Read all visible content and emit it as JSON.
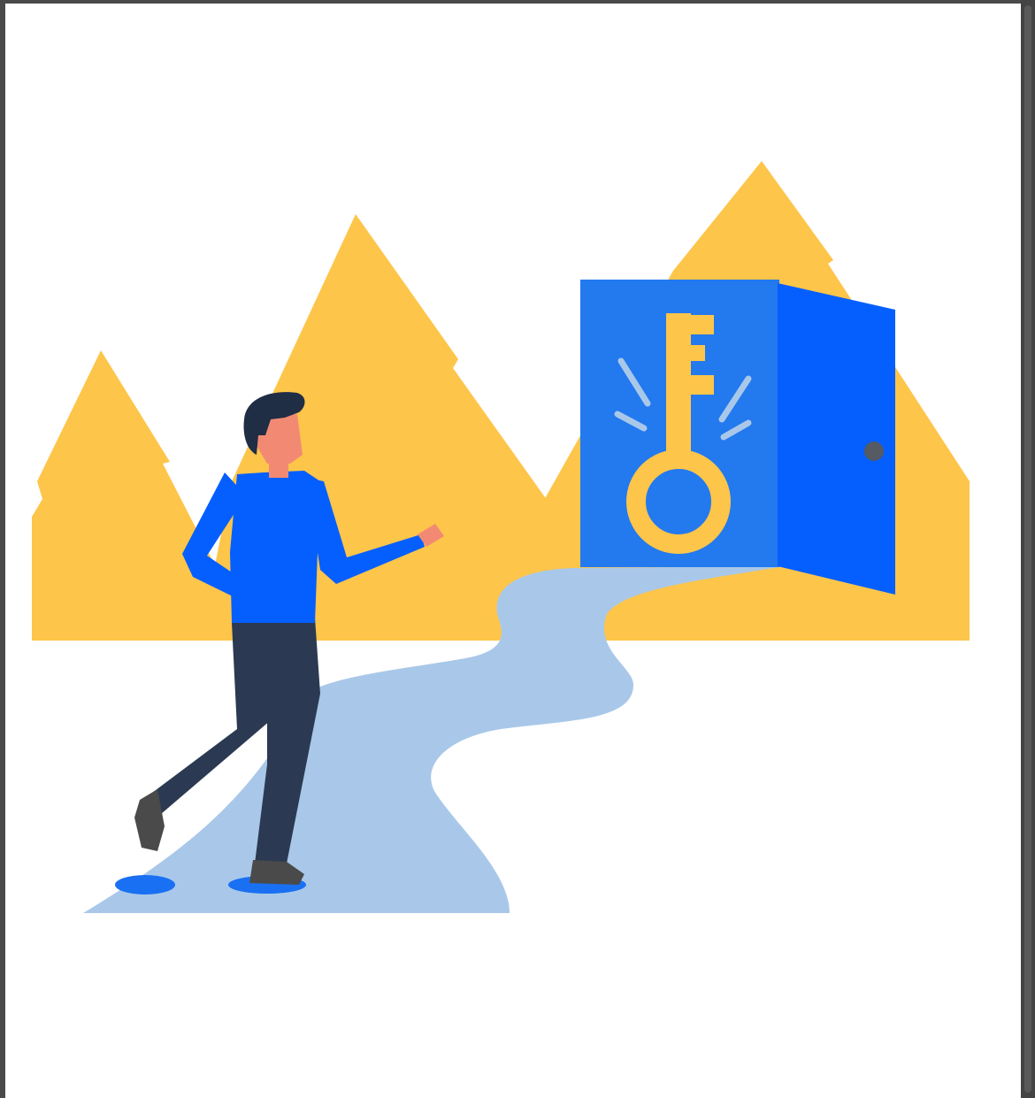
{
  "colors": {
    "background": "#ffffff",
    "frame": "#4a4a4a",
    "mountains": "#fdc54a",
    "path": "#a9c8e9",
    "door_front": "#2379ee",
    "door_open": "#045ffe",
    "key": "#fdc54a",
    "key_rays": "#a9c8e9",
    "shirt": "#045ffe",
    "pants": "#2b3a52",
    "skin": "#f28a73",
    "hair": "#1f2d45",
    "shoes": "#4a4a4a",
    "footprint": "#1a70f2"
  },
  "illustration": {
    "icons": [
      "mountain-icon",
      "key-icon",
      "door-icon",
      "person-icon",
      "footprint-icon"
    ]
  }
}
